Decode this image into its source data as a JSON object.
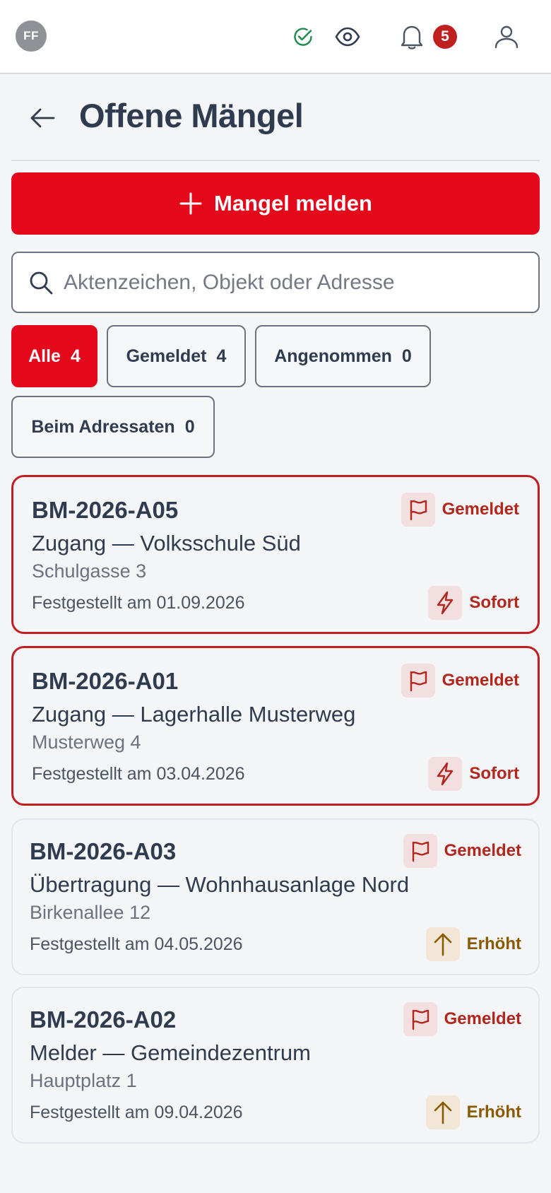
{
  "header": {
    "avatar_initials": "FF",
    "notification_count": "5",
    "icons": [
      "check-circle-icon",
      "eye-icon",
      "bell-icon",
      "user-icon"
    ]
  },
  "page": {
    "title": "Offene Mängel"
  },
  "actions": {
    "report_label": "Mangel melden"
  },
  "search": {
    "placeholder": "Aktenzeichen, Objekt oder Adresse",
    "value": ""
  },
  "filters": [
    {
      "label": "Alle",
      "count": "4",
      "active": true
    },
    {
      "label": "Gemeldet",
      "count": "4",
      "active": false
    },
    {
      "label": "Angenommen",
      "count": "0",
      "active": false
    },
    {
      "label": "Beim Adressaten",
      "count": "0",
      "active": false
    }
  ],
  "defects": [
    {
      "ref": "BM-2026-A05",
      "title": "Zugang — Volksschule Süd",
      "address": "Schulgasse 3",
      "date": "Festgestellt am 01.09.2026",
      "status": "Gemeldet",
      "priority": "Sofort",
      "priority_icon": "lightning-icon"
    },
    {
      "ref": "BM-2026-A01",
      "title": "Zugang — Lagerhalle Musterweg",
      "address": "Musterweg 4",
      "date": "Festgestellt am 03.04.2026",
      "status": "Gemeldet",
      "priority": "Sofort",
      "priority_icon": "lightning-icon"
    },
    {
      "ref": "BM-2026-A03",
      "title": "Übertragung — Wohnhausanlage Nord",
      "address": "Birkenallee 12",
      "date": "Festgestellt am 04.05.2026",
      "status": "Gemeldet",
      "priority": "Erhöht",
      "priority_icon": "arrow-up-icon"
    },
    {
      "ref": "BM-2026-A02",
      "title": "Melder — Gemeindezentrum",
      "address": "Hauptplatz 1",
      "date": "Festgestellt am 09.04.2026",
      "status": "Gemeldet",
      "priority": "Erhöht",
      "priority_icon": "arrow-up-icon"
    }
  ],
  "colors": {
    "primary_red": "#e3091b",
    "urgent_border": "#c21f24",
    "status_text": "#b3261e",
    "elevated_text": "#8a5a00",
    "check_green": "#1e8a4c"
  }
}
